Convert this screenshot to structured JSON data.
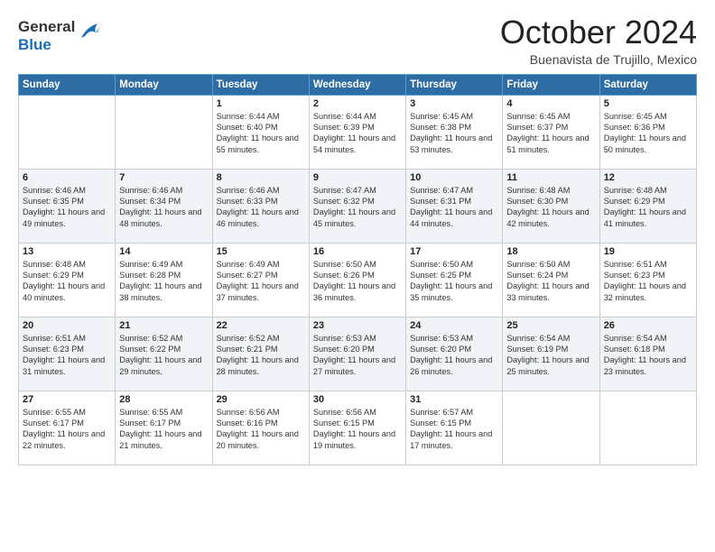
{
  "header": {
    "logo_line1": "General",
    "logo_line2": "Blue",
    "title": "October 2024",
    "location": "Buenavista de Trujillo, Mexico"
  },
  "days_of_week": [
    "Sunday",
    "Monday",
    "Tuesday",
    "Wednesday",
    "Thursday",
    "Friday",
    "Saturday"
  ],
  "weeks": [
    [
      {
        "day": "",
        "content": ""
      },
      {
        "day": "",
        "content": ""
      },
      {
        "day": "1",
        "content": "Sunrise: 6:44 AM\nSunset: 6:40 PM\nDaylight: 11 hours\nand 55 minutes."
      },
      {
        "day": "2",
        "content": "Sunrise: 6:44 AM\nSunset: 6:39 PM\nDaylight: 11 hours\nand 54 minutes."
      },
      {
        "day": "3",
        "content": "Sunrise: 6:45 AM\nSunset: 6:38 PM\nDaylight: 11 hours\nand 53 minutes."
      },
      {
        "day": "4",
        "content": "Sunrise: 6:45 AM\nSunset: 6:37 PM\nDaylight: 11 hours\nand 51 minutes."
      },
      {
        "day": "5",
        "content": "Sunrise: 6:45 AM\nSunset: 6:36 PM\nDaylight: 11 hours\nand 50 minutes."
      }
    ],
    [
      {
        "day": "6",
        "content": "Sunrise: 6:46 AM\nSunset: 6:35 PM\nDaylight: 11 hours\nand 49 minutes."
      },
      {
        "day": "7",
        "content": "Sunrise: 6:46 AM\nSunset: 6:34 PM\nDaylight: 11 hours\nand 48 minutes."
      },
      {
        "day": "8",
        "content": "Sunrise: 6:46 AM\nSunset: 6:33 PM\nDaylight: 11 hours\nand 46 minutes."
      },
      {
        "day": "9",
        "content": "Sunrise: 6:47 AM\nSunset: 6:32 PM\nDaylight: 11 hours\nand 45 minutes."
      },
      {
        "day": "10",
        "content": "Sunrise: 6:47 AM\nSunset: 6:31 PM\nDaylight: 11 hours\nand 44 minutes."
      },
      {
        "day": "11",
        "content": "Sunrise: 6:48 AM\nSunset: 6:30 PM\nDaylight: 11 hours\nand 42 minutes."
      },
      {
        "day": "12",
        "content": "Sunrise: 6:48 AM\nSunset: 6:29 PM\nDaylight: 11 hours\nand 41 minutes."
      }
    ],
    [
      {
        "day": "13",
        "content": "Sunrise: 6:48 AM\nSunset: 6:29 PM\nDaylight: 11 hours\nand 40 minutes."
      },
      {
        "day": "14",
        "content": "Sunrise: 6:49 AM\nSunset: 6:28 PM\nDaylight: 11 hours\nand 38 minutes."
      },
      {
        "day": "15",
        "content": "Sunrise: 6:49 AM\nSunset: 6:27 PM\nDaylight: 11 hours\nand 37 minutes."
      },
      {
        "day": "16",
        "content": "Sunrise: 6:50 AM\nSunset: 6:26 PM\nDaylight: 11 hours\nand 36 minutes."
      },
      {
        "day": "17",
        "content": "Sunrise: 6:50 AM\nSunset: 6:25 PM\nDaylight: 11 hours\nand 35 minutes."
      },
      {
        "day": "18",
        "content": "Sunrise: 6:50 AM\nSunset: 6:24 PM\nDaylight: 11 hours\nand 33 minutes."
      },
      {
        "day": "19",
        "content": "Sunrise: 6:51 AM\nSunset: 6:23 PM\nDaylight: 11 hours\nand 32 minutes."
      }
    ],
    [
      {
        "day": "20",
        "content": "Sunrise: 6:51 AM\nSunset: 6:23 PM\nDaylight: 11 hours\nand 31 minutes."
      },
      {
        "day": "21",
        "content": "Sunrise: 6:52 AM\nSunset: 6:22 PM\nDaylight: 11 hours\nand 29 minutes."
      },
      {
        "day": "22",
        "content": "Sunrise: 6:52 AM\nSunset: 6:21 PM\nDaylight: 11 hours\nand 28 minutes."
      },
      {
        "day": "23",
        "content": "Sunrise: 6:53 AM\nSunset: 6:20 PM\nDaylight: 11 hours\nand 27 minutes."
      },
      {
        "day": "24",
        "content": "Sunrise: 6:53 AM\nSunset: 6:20 PM\nDaylight: 11 hours\nand 26 minutes."
      },
      {
        "day": "25",
        "content": "Sunrise: 6:54 AM\nSunset: 6:19 PM\nDaylight: 11 hours\nand 25 minutes."
      },
      {
        "day": "26",
        "content": "Sunrise: 6:54 AM\nSunset: 6:18 PM\nDaylight: 11 hours\nand 23 minutes."
      }
    ],
    [
      {
        "day": "27",
        "content": "Sunrise: 6:55 AM\nSunset: 6:17 PM\nDaylight: 11 hours\nand 22 minutes."
      },
      {
        "day": "28",
        "content": "Sunrise: 6:55 AM\nSunset: 6:17 PM\nDaylight: 11 hours\nand 21 minutes."
      },
      {
        "day": "29",
        "content": "Sunrise: 6:56 AM\nSunset: 6:16 PM\nDaylight: 11 hours\nand 20 minutes."
      },
      {
        "day": "30",
        "content": "Sunrise: 6:56 AM\nSunset: 6:15 PM\nDaylight: 11 hours\nand 19 minutes."
      },
      {
        "day": "31",
        "content": "Sunrise: 6:57 AM\nSunset: 6:15 PM\nDaylight: 11 hours\nand 17 minutes."
      },
      {
        "day": "",
        "content": ""
      },
      {
        "day": "",
        "content": ""
      }
    ]
  ]
}
